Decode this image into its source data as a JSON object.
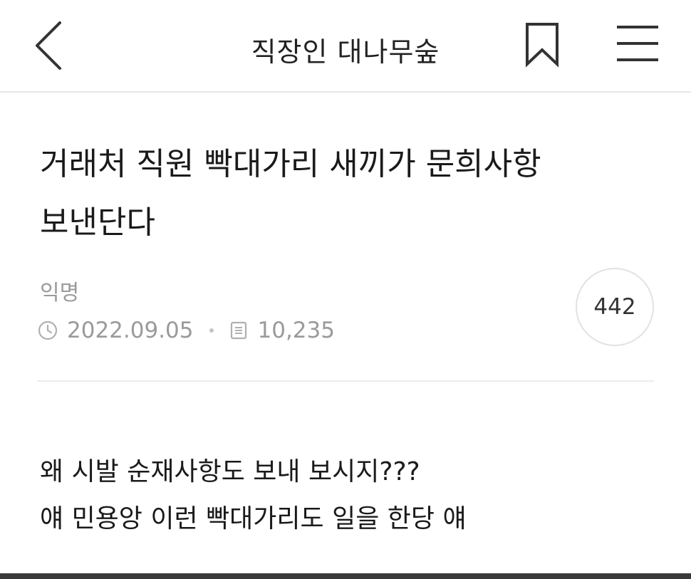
{
  "header": {
    "title": "직장인 대나무숲",
    "back_icon": "chevron-left-icon",
    "bookmark_icon": "bookmark-icon",
    "menu_icon": "hamburger-menu-icon"
  },
  "post": {
    "title_line1": "거래처 직원 빡대가리 새끼가 문희사항",
    "title_line2": "보낸단다",
    "author": "익명",
    "date": "2022.09.05",
    "views": "10,235",
    "comment_count": "442",
    "body_line1": "왜 시발 순재사항도 보내 보시지???",
    "body_line2": "얘 민용앙 이런 빡대가리도 일을 한당 얘"
  },
  "colors": {
    "text": "#1a1a1a",
    "meta_gray": "#9a9a9a",
    "divider": "#ececec"
  }
}
